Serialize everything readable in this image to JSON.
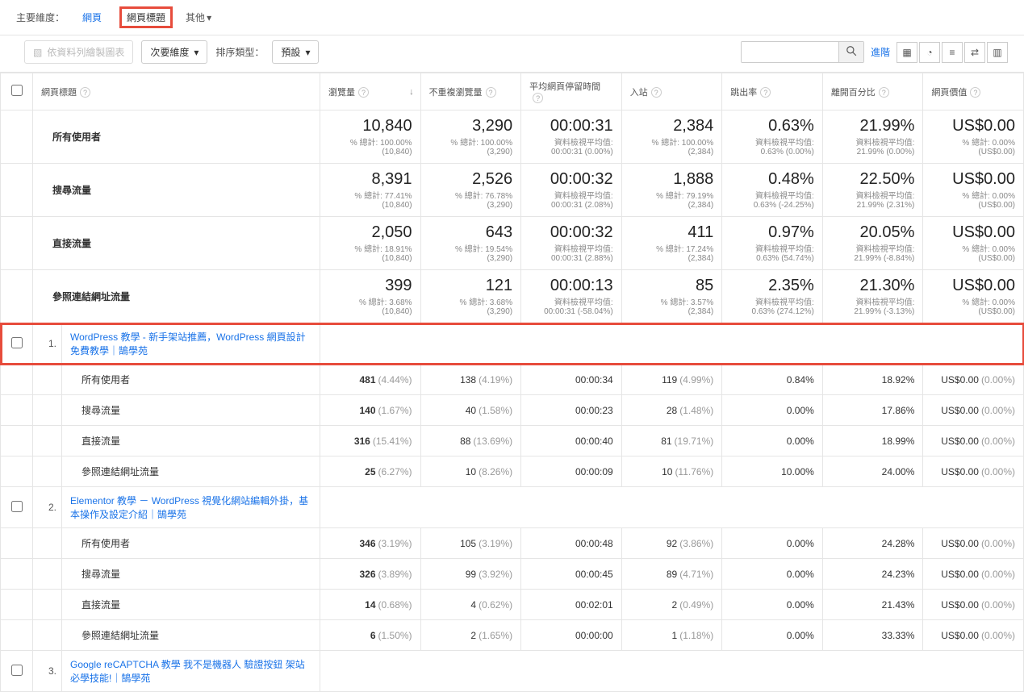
{
  "topbar": {
    "primary_dim_label": "主要維度：",
    "tabs": [
      "網頁",
      "網頁標題",
      "其他"
    ],
    "active_tab": 1
  },
  "secondrow": {
    "plot_by_label": "依資料列繪製圖表",
    "secondary_dim_label": "次要維度",
    "sort_label": "排序類型：",
    "sort_value": "預設",
    "advanced_label": "進階"
  },
  "columns": {
    "page_title": "網頁標題",
    "pageviews": "瀏覽量",
    "unique": "不重複瀏覽量",
    "avg_time": "平均網頁停留時間",
    "entrances": "入站",
    "bounce": "跳出率",
    "exit": "離開百分比",
    "value": "網頁價值"
  },
  "segments": [
    {
      "name": "所有使用者",
      "metrics": {
        "pageviews": {
          "big": "10,840",
          "sub1": "% 總計: 100.00%",
          "sub2": "(10,840)"
        },
        "unique": {
          "big": "3,290",
          "sub1": "% 總計: 100.00%",
          "sub2": "(3,290)"
        },
        "avg_time": {
          "big": "00:00:31",
          "sub1": "資料檢視平均值:",
          "sub2": "00:00:31 (0.00%)"
        },
        "entrances": {
          "big": "2,384",
          "sub1": "% 總計: 100.00%",
          "sub2": "(2,384)"
        },
        "bounce": {
          "big": "0.63%",
          "sub1": "資料檢視平均值:",
          "sub2": "0.63% (0.00%)"
        },
        "exit": {
          "big": "21.99%",
          "sub1": "資料檢視平均值:",
          "sub2": "21.99% (0.00%)"
        },
        "value": {
          "big": "US$0.00",
          "sub1": "% 總計: 0.00%",
          "sub2": "(US$0.00)"
        }
      }
    },
    {
      "name": "搜尋流量",
      "metrics": {
        "pageviews": {
          "big": "8,391",
          "sub1": "% 總計: 77.41%",
          "sub2": "(10,840)"
        },
        "unique": {
          "big": "2,526",
          "sub1": "% 總計: 76.78%",
          "sub2": "(3,290)"
        },
        "avg_time": {
          "big": "00:00:32",
          "sub1": "資料檢視平均值:",
          "sub2": "00:00:31 (2.08%)"
        },
        "entrances": {
          "big": "1,888",
          "sub1": "% 總計: 79.19%",
          "sub2": "(2,384)"
        },
        "bounce": {
          "big": "0.48%",
          "sub1": "資料檢視平均值:",
          "sub2": "0.63% (-24.25%)"
        },
        "exit": {
          "big": "22.50%",
          "sub1": "資料檢視平均值:",
          "sub2": "21.99% (2.31%)"
        },
        "value": {
          "big": "US$0.00",
          "sub1": "% 總計: 0.00%",
          "sub2": "(US$0.00)"
        }
      }
    },
    {
      "name": "直接流量",
      "metrics": {
        "pageviews": {
          "big": "2,050",
          "sub1": "% 總計: 18.91%",
          "sub2": "(10,840)"
        },
        "unique": {
          "big": "643",
          "sub1": "% 總計: 19.54%",
          "sub2": "(3,290)"
        },
        "avg_time": {
          "big": "00:00:32",
          "sub1": "資料檢視平均值:",
          "sub2": "00:00:31 (2.88%)"
        },
        "entrances": {
          "big": "411",
          "sub1": "% 總計: 17.24%",
          "sub2": "(2,384)"
        },
        "bounce": {
          "big": "0.97%",
          "sub1": "資料檢視平均值:",
          "sub2": "0.63% (54.74%)"
        },
        "exit": {
          "big": "20.05%",
          "sub1": "資料檢視平均值:",
          "sub2": "21.99% (-8.84%)"
        },
        "value": {
          "big": "US$0.00",
          "sub1": "% 總計: 0.00%",
          "sub2": "(US$0.00)"
        }
      }
    },
    {
      "name": "參照連結網址流量",
      "metrics": {
        "pageviews": {
          "big": "399",
          "sub1": "% 總計: 3.68%",
          "sub2": "(10,840)"
        },
        "unique": {
          "big": "121",
          "sub1": "% 總計: 3.68%",
          "sub2": "(3,290)"
        },
        "avg_time": {
          "big": "00:00:13",
          "sub1": "資料檢視平均值:",
          "sub2": "00:00:31 (-58.04%)"
        },
        "entrances": {
          "big": "85",
          "sub1": "% 總計: 3.57%",
          "sub2": "(2,384)"
        },
        "bounce": {
          "big": "2.35%",
          "sub1": "資料檢視平均值:",
          "sub2": "0.63% (274.12%)"
        },
        "exit": {
          "big": "21.30%",
          "sub1": "資料檢視平均值:",
          "sub2": "21.99% (-3.13%)"
        },
        "value": {
          "big": "US$0.00",
          "sub1": "% 總計: 0.00%",
          "sub2": "(US$0.00)"
        }
      }
    }
  ],
  "pages": [
    {
      "idx": "1.",
      "title": "WordPress 教學 - 新手架站推薦，WordPress 網頁設計免費教學｜鵠學苑",
      "highlight": true,
      "rows": [
        {
          "seg": "所有使用者",
          "pv": "481",
          "pvp": "(4.44%)",
          "uq": "138",
          "uqp": "(4.19%)",
          "t": "00:00:34",
          "en": "119",
          "enp": "(4.99%)",
          "bn": "0.84%",
          "ex": "18.92%",
          "va": "US$0.00",
          "vap": "(0.00%)"
        },
        {
          "seg": "搜尋流量",
          "pv": "140",
          "pvp": "(1.67%)",
          "uq": "40",
          "uqp": "(1.58%)",
          "t": "00:00:23",
          "en": "28",
          "enp": "(1.48%)",
          "bn": "0.00%",
          "ex": "17.86%",
          "va": "US$0.00",
          "vap": "(0.00%)"
        },
        {
          "seg": "直接流量",
          "pv": "316",
          "pvp": "(15.41%)",
          "uq": "88",
          "uqp": "(13.69%)",
          "t": "00:00:40",
          "en": "81",
          "enp": "(19.71%)",
          "bn": "0.00%",
          "ex": "18.99%",
          "va": "US$0.00",
          "vap": "(0.00%)"
        },
        {
          "seg": "參照連結網址流量",
          "pv": "25",
          "pvp": "(6.27%)",
          "uq": "10",
          "uqp": "(8.26%)",
          "t": "00:00:09",
          "en": "10",
          "enp": "(11.76%)",
          "bn": "10.00%",
          "ex": "24.00%",
          "va": "US$0.00",
          "vap": "(0.00%)"
        }
      ]
    },
    {
      "idx": "2.",
      "title": "Elementor 教學 － WordPress 視覺化網站編輯外掛，基本操作及設定介紹｜鵠學苑",
      "highlight": false,
      "rows": [
        {
          "seg": "所有使用者",
          "pv": "346",
          "pvp": "(3.19%)",
          "uq": "105",
          "uqp": "(3.19%)",
          "t": "00:00:48",
          "en": "92",
          "enp": "(3.86%)",
          "bn": "0.00%",
          "ex": "24.28%",
          "va": "US$0.00",
          "vap": "(0.00%)"
        },
        {
          "seg": "搜尋流量",
          "pv": "326",
          "pvp": "(3.89%)",
          "uq": "99",
          "uqp": "(3.92%)",
          "t": "00:00:45",
          "en": "89",
          "enp": "(4.71%)",
          "bn": "0.00%",
          "ex": "24.23%",
          "va": "US$0.00",
          "vap": "(0.00%)"
        },
        {
          "seg": "直接流量",
          "pv": "14",
          "pvp": "(0.68%)",
          "uq": "4",
          "uqp": "(0.62%)",
          "t": "00:02:01",
          "en": "2",
          "enp": "(0.49%)",
          "bn": "0.00%",
          "ex": "21.43%",
          "va": "US$0.00",
          "vap": "(0.00%)"
        },
        {
          "seg": "參照連結網址流量",
          "pv": "6",
          "pvp": "(1.50%)",
          "uq": "2",
          "uqp": "(1.65%)",
          "t": "00:00:00",
          "en": "1",
          "enp": "(1.18%)",
          "bn": "0.00%",
          "ex": "33.33%",
          "va": "US$0.00",
          "vap": "(0.00%)"
        }
      ]
    },
    {
      "idx": "3.",
      "title": "Google reCAPTCHA 教學 我不是機器人 驗證按鈕 架站必學技能!｜鵠學苑",
      "highlight": false,
      "rows": []
    }
  ]
}
